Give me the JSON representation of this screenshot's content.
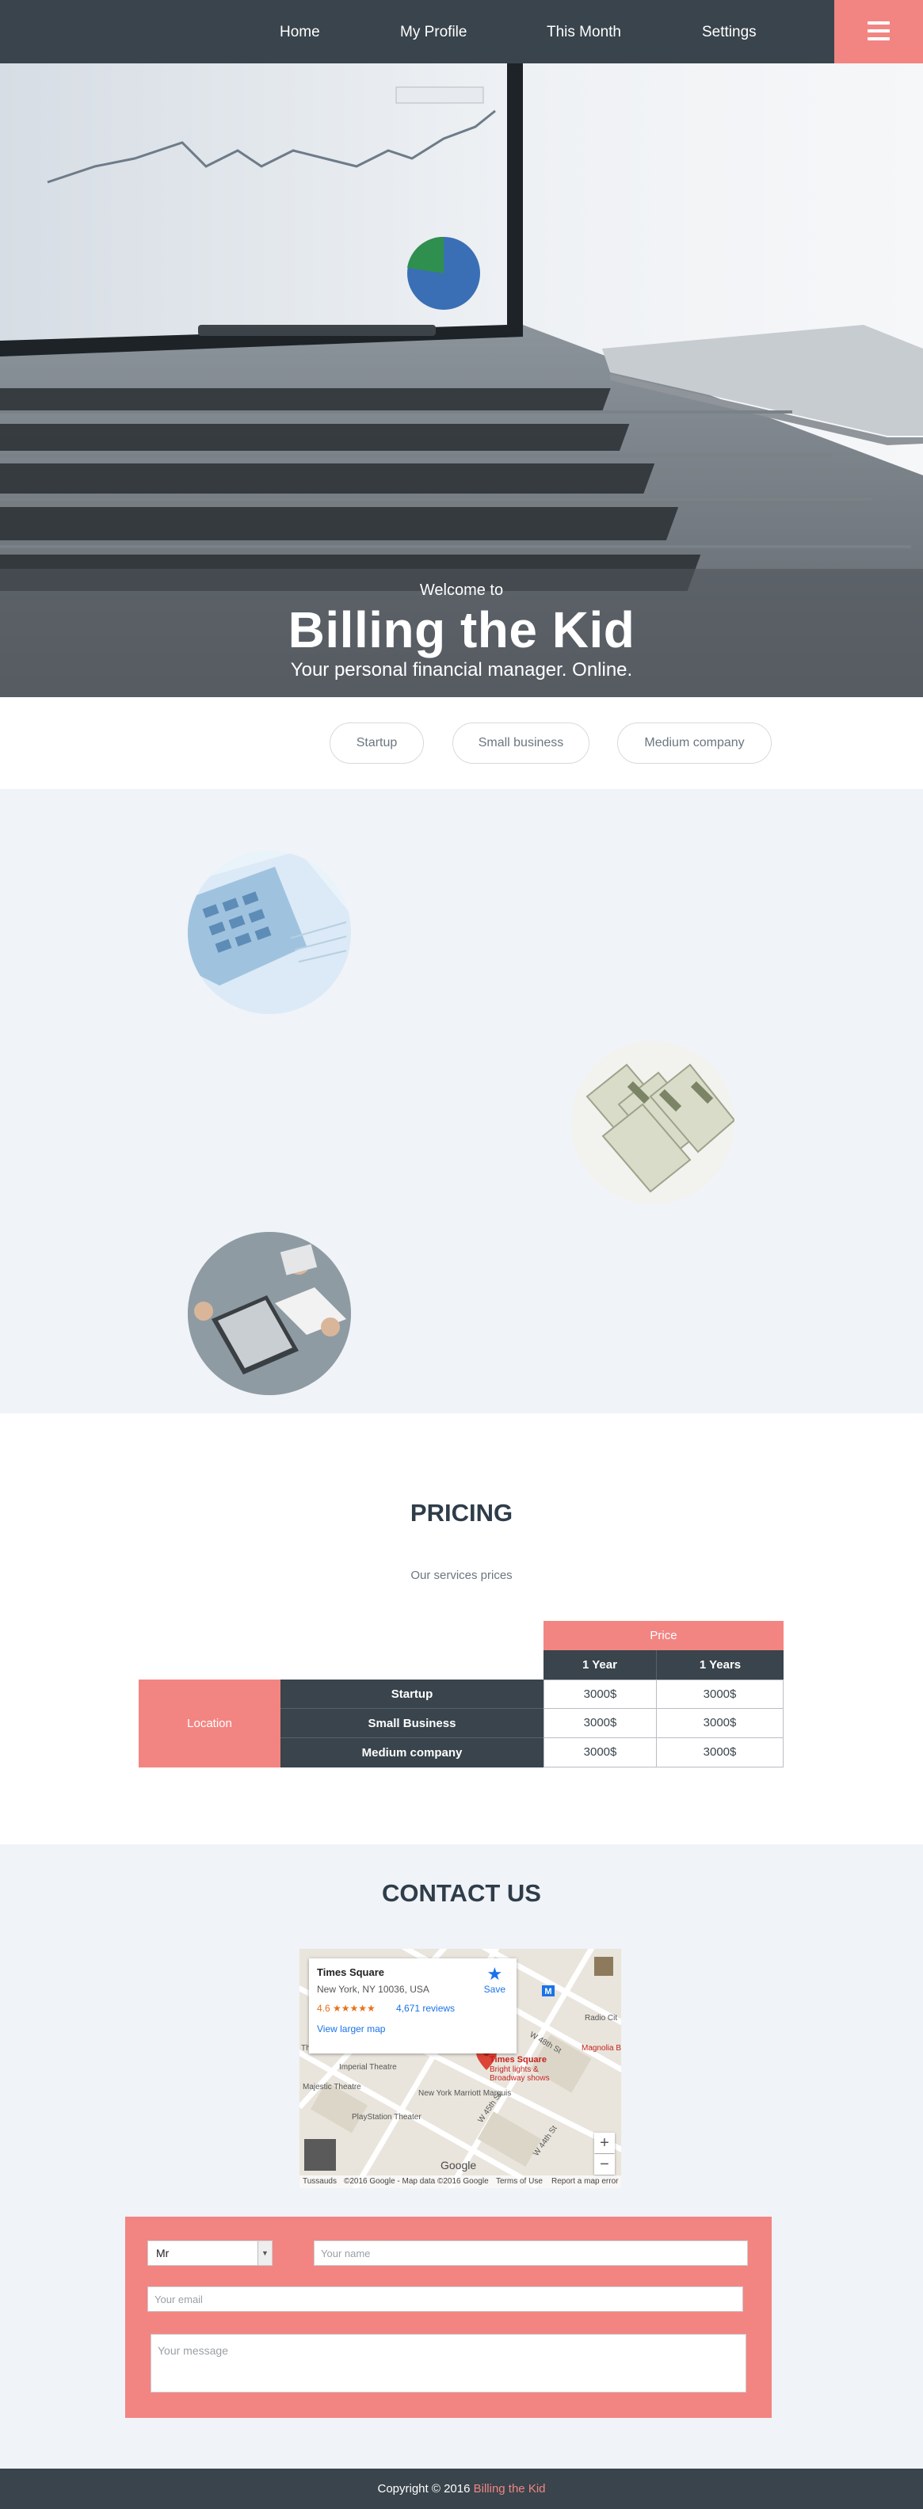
{
  "nav": {
    "items": [
      {
        "label": "Home"
      },
      {
        "label": "My Profile"
      },
      {
        "label": "This Month"
      },
      {
        "label": "Settings"
      }
    ],
    "menu_icon": "hamburger-icon"
  },
  "hero": {
    "welcome": "Welcome to",
    "title": "Billing the Kid",
    "subtitle": "Your personal financial manager. Online."
  },
  "tabs": [
    {
      "label": "Startup"
    },
    {
      "label": "Small business"
    },
    {
      "label": "Medium company"
    }
  ],
  "pricing": {
    "title": "PRICING",
    "subtitle": "Our services prices",
    "price_header": "Price",
    "columns": [
      "1 Year",
      "1 Years"
    ],
    "row_group_label": "Location",
    "rows": [
      {
        "name": "Startup",
        "values": [
          "3000$",
          "3000$"
        ]
      },
      {
        "name": "Small Business",
        "values": [
          "3000$",
          "3000$"
        ]
      },
      {
        "name": "Medium company",
        "values": [
          "3000$",
          "3000$"
        ]
      }
    ]
  },
  "contact": {
    "title": "CONTACT US",
    "map": {
      "place": "Times Square",
      "address": "New York, NY 10036, USA",
      "rating": "4.6 ★★★★★",
      "reviews": "4,671 reviews",
      "larger_map": "View larger map",
      "save": "Save",
      "pin_label": "Times Square",
      "pin_sub1": "Bright lights &",
      "pin_sub2": "Broadway shows",
      "streets": [
        "Imperial Theatre",
        "Majestic Theatre",
        "New York Marriott Marquis",
        "PlayStation Theater",
        "W 45th St",
        "W 44th St",
        "W 48th St",
        "Radio Cit",
        "Magnolia B",
        "Theatre"
      ],
      "footer": [
        "©2016 Google - Map data ©2016 Google",
        "Terms of Use",
        "Report a map error"
      ],
      "footer_left": "Tussauds",
      "logo": "Google",
      "zoom_in": "+",
      "zoom_out": "−"
    },
    "form": {
      "title_select": "Mr",
      "name_placeholder": "Your name",
      "email_placeholder": "Your email",
      "message_placeholder": "Your message"
    }
  },
  "footer": {
    "copyright": "Copyright © 2016",
    "brand": "Billing the Kid"
  },
  "colors": {
    "accent": "#f28582",
    "dark": "#39444c",
    "light_bg": "#f0f3f7"
  }
}
